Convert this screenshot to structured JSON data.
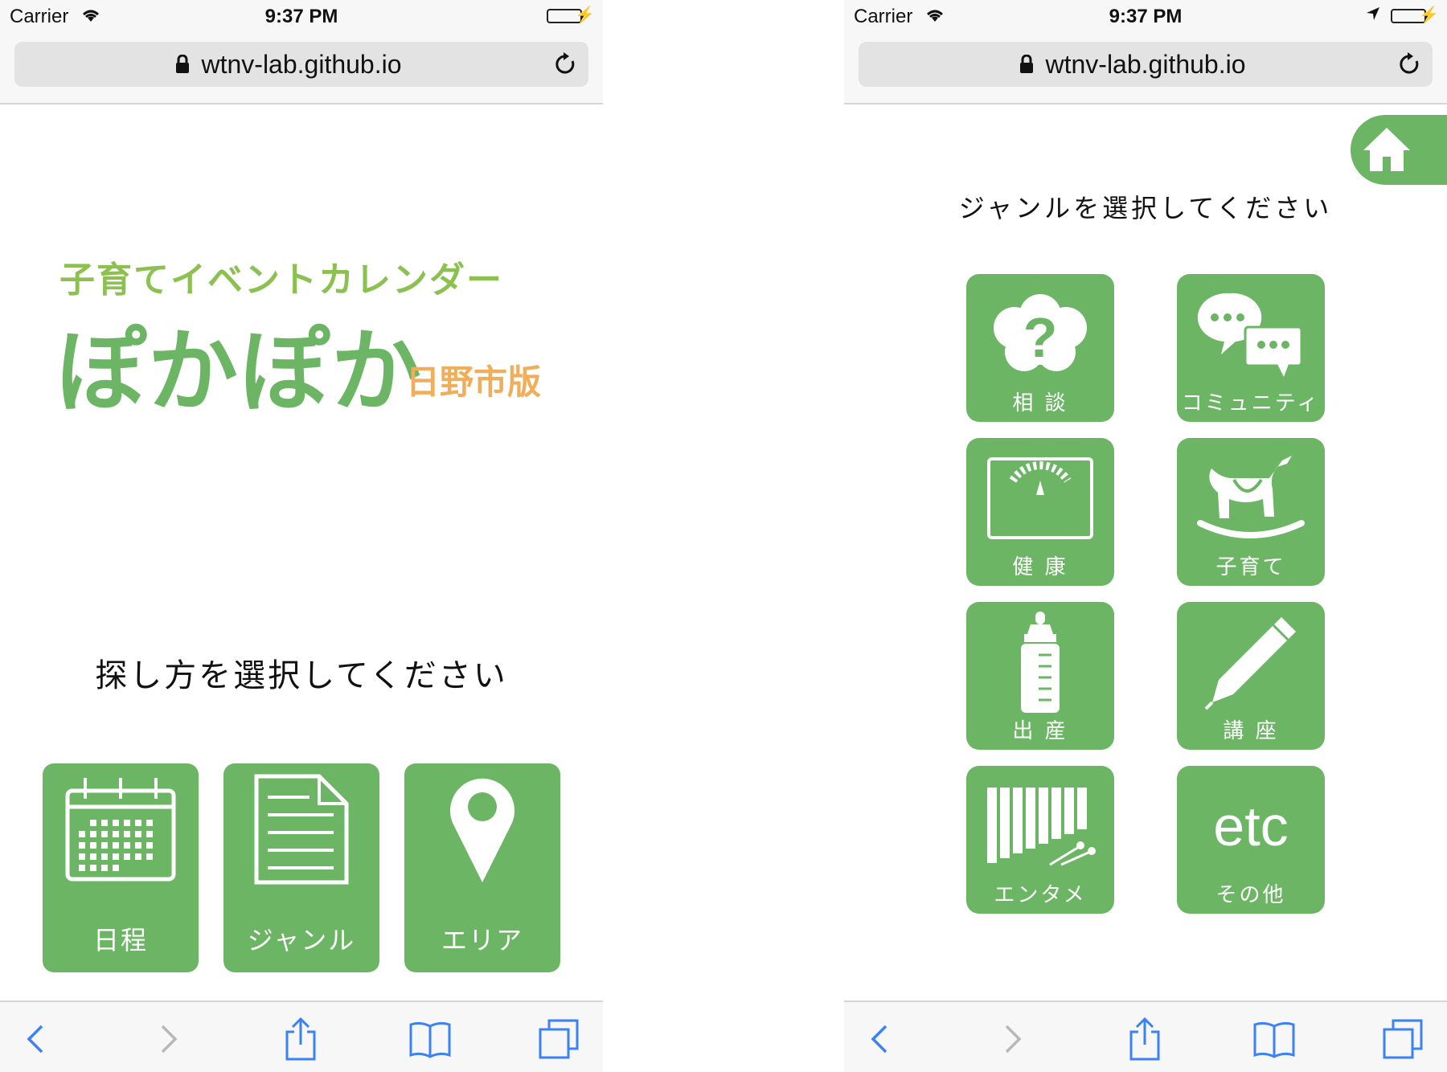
{
  "status_bar": {
    "carrier": "Carrier",
    "time": "9:37 PM"
  },
  "browser": {
    "url": "wtnv-lab.github.io"
  },
  "left_screen": {
    "subtitle": "子育てイベントカレンダー",
    "logo": "ぽかぽか",
    "edition": "日野市版",
    "prompt": "探し方を選択してください",
    "buttons": [
      {
        "label": "日程",
        "icon": "calendar-icon"
      },
      {
        "label": "ジャンル",
        "icon": "document-icon"
      },
      {
        "label": "エリア",
        "icon": "map-pin-icon"
      }
    ]
  },
  "right_screen": {
    "prompt": "ジャンルを選択してください",
    "genres": [
      {
        "label": "相 談",
        "icon": "question-cloud-icon"
      },
      {
        "label": "コミュニティ",
        "icon": "chat-bubbles-icon"
      },
      {
        "label": "健 康",
        "icon": "scale-icon"
      },
      {
        "label": "子育て",
        "icon": "rocking-horse-icon"
      },
      {
        "label": "出 産",
        "icon": "baby-bottle-icon"
      },
      {
        "label": "講 座",
        "icon": "pencil-icon"
      },
      {
        "label": "エンタメ",
        "icon": "xylophone-icon"
      },
      {
        "label": "その他",
        "icon": "etc-icon",
        "icon_text": "etc"
      }
    ]
  },
  "colors": {
    "accent": "#6cb565",
    "subtitle": "#8cc152",
    "edition": "#f0ad5a",
    "safari_blue": "#3b82f6"
  }
}
